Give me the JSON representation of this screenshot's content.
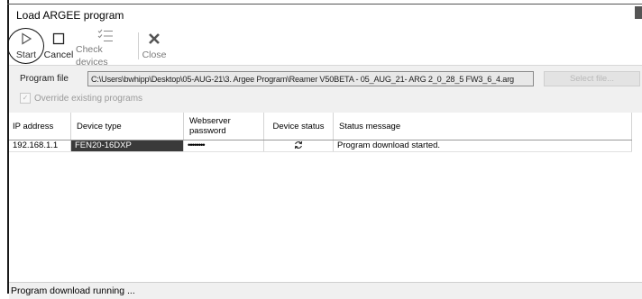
{
  "window": {
    "title": "Load ARGEE program"
  },
  "toolbar": {
    "start_label": "Start",
    "cancel_label": "Cancel",
    "check_devices_label": "Check devices",
    "close_label": "Close"
  },
  "file": {
    "label": "Program file",
    "path": "C:\\Users\\bwhipp\\Desktop\\05-AUG-21\\3. Argee Program\\Reamer V50BETA - 05_AUG_21- ARG 2_0_28_5 FW3_6_4.arg",
    "select_label": "Select file...",
    "override_label": "Override existing programs",
    "override_checked": true
  },
  "table": {
    "headers": {
      "ip": "IP address",
      "type": "Device type",
      "password": "Webserver password",
      "status": "Device status",
      "message": "Status message"
    },
    "rows": [
      {
        "ip": "192.168.1.1",
        "type": "FEN20-16DXP",
        "password": "••••••••",
        "status_icon": "refresh-icon",
        "message": "Program download started."
      }
    ]
  },
  "status": {
    "text": "Program download running ..."
  }
}
